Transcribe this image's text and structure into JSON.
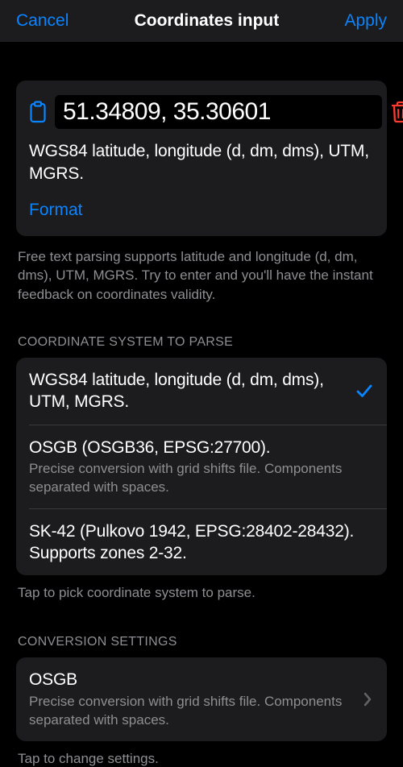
{
  "navbar": {
    "cancel": "Cancel",
    "title": "Coordinates input",
    "apply": "Apply"
  },
  "input": {
    "value": "51.34809, 35.30601",
    "description": "WGS84 latitude, longitude (d, dm, dms), UTM, MGRS.",
    "format_link": "Format",
    "help": "Free text parsing supports latitude and longitude (d, dm, dms), UTM, MGRS. Try to enter and you'll have the instant feedback on coordinates validity."
  },
  "coord_system": {
    "header": "COORDINATE SYSTEM TO PARSE",
    "items": [
      {
        "title": "WGS84 latitude, longitude (d, dm, dms), UTM, MGRS.",
        "subtitle": "",
        "selected": true
      },
      {
        "title": "OSGB (OSGB36, EPSG:27700).",
        "subtitle": "Precise conversion with grid shifts file. Components separated with spaces.",
        "selected": false
      },
      {
        "title": "SK-42 (Pulkovo 1942, EPSG:28402-28432). Supports zones 2-32.",
        "subtitle": "",
        "selected": false
      }
    ],
    "footer": "Tap to pick coordinate system to parse."
  },
  "conversion": {
    "header": "CONVERSION SETTINGS",
    "title": "OSGB",
    "subtitle": "Precise conversion with grid shifts file. Components separated with spaces.",
    "footer": "Tap to change settings."
  }
}
